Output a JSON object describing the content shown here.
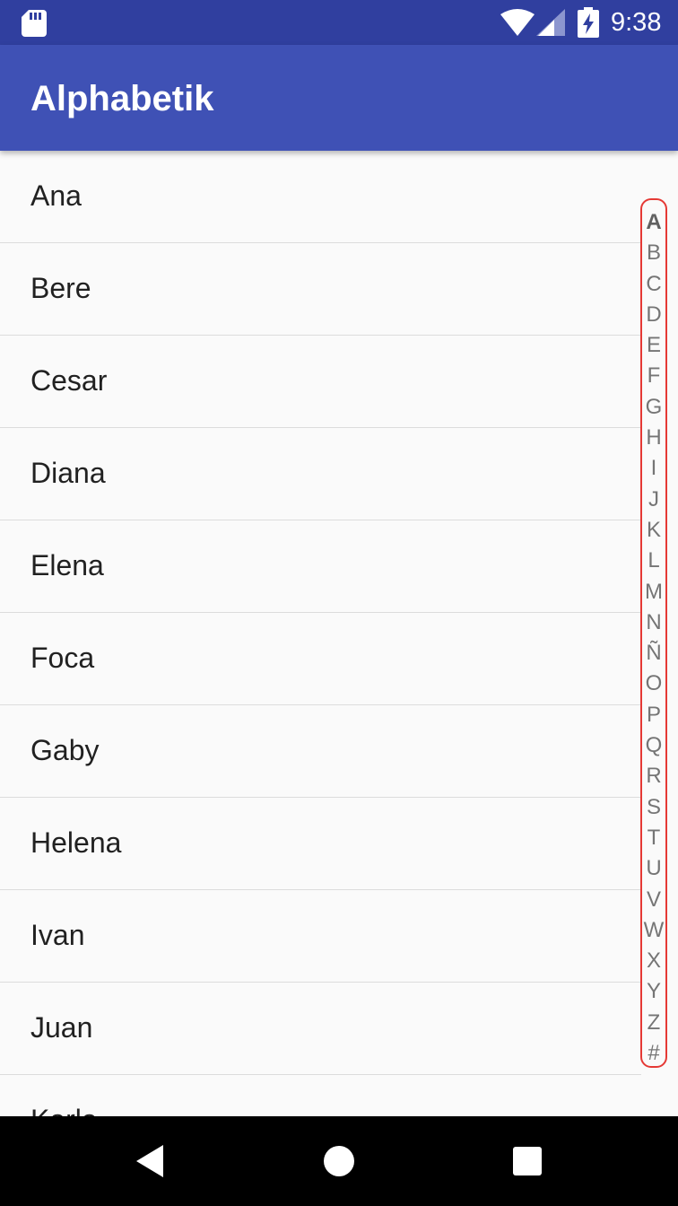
{
  "status_bar": {
    "time": "9:38",
    "icons": [
      "sd-card-icon",
      "wifi-icon",
      "signal-icon",
      "battery-charging-icon"
    ]
  },
  "app_bar": {
    "title": "Alphabetik"
  },
  "list": {
    "items": [
      {
        "name": "Ana"
      },
      {
        "name": "Bere"
      },
      {
        "name": "Cesar"
      },
      {
        "name": "Diana"
      },
      {
        "name": "Elena"
      },
      {
        "name": "Foca"
      },
      {
        "name": "Gaby"
      },
      {
        "name": "Helena"
      },
      {
        "name": "Ivan"
      },
      {
        "name": "Juan"
      },
      {
        "name": "Karla"
      }
    ]
  },
  "alphabet_index": {
    "letters": [
      "A",
      "B",
      "C",
      "D",
      "E",
      "F",
      "G",
      "H",
      "I",
      "J",
      "K",
      "L",
      "M",
      "N",
      "Ñ",
      "O",
      "P",
      "Q",
      "R",
      "S",
      "T",
      "U",
      "V",
      "W",
      "X",
      "Y",
      "Z",
      "#"
    ],
    "selected": "A",
    "border_color": "#e53935"
  },
  "nav_bar": {
    "icons": [
      "back-icon",
      "home-icon",
      "recents-icon"
    ]
  },
  "colors": {
    "primary": "#3f51b5",
    "primary_dark": "#303f9f",
    "background": "#fafafa"
  }
}
